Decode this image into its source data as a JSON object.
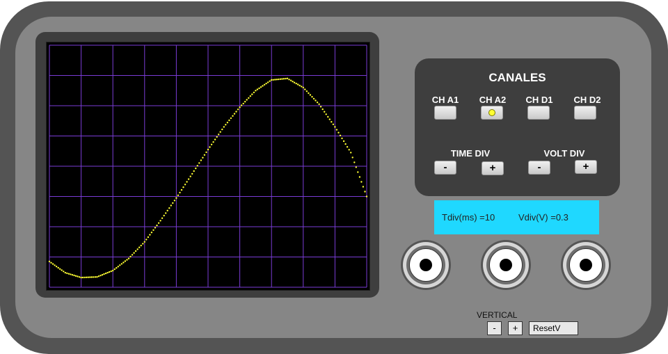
{
  "panel": {
    "title": "CANALES",
    "channels": [
      {
        "label": "CH A1",
        "active": false
      },
      {
        "label": "CH A2",
        "active": true
      },
      {
        "label": "CH D1",
        "active": false
      },
      {
        "label": "CH D2",
        "active": false
      }
    ],
    "time_div_label": "TIME DIV",
    "volt_div_label": "VOLT DIV",
    "minus": "-",
    "plus": "+"
  },
  "readout": {
    "tdiv": "Tdiv(ms) =10",
    "vdiv": "Vdiv(V) =0.3"
  },
  "vertical": {
    "label": "VERTICAL",
    "minus": "-",
    "plus": "+",
    "reset": "ResetV"
  },
  "colors": {
    "trace": "#ffff33",
    "grid": "#7a3cd6",
    "readout_bg": "#1fd8ff",
    "case_outer": "#545454",
    "case_inner": "#868686"
  },
  "chart_data": {
    "type": "line",
    "grid_divisions": {
      "x": 10,
      "y": 8
    },
    "series": [
      {
        "name": "",
        "x": [
          0,
          0.5,
          1,
          1.5,
          2,
          2.5,
          3,
          3.5,
          4,
          4.5,
          5,
          5.5,
          6,
          6.5,
          7,
          7.5,
          8,
          8.5,
          9,
          9.5,
          10
        ],
        "y": [
          0.85,
          0.48,
          0.32,
          0.34,
          0.55,
          0.95,
          1.5,
          2.2,
          2.95,
          3.75,
          4.55,
          5.3,
          5.95,
          6.5,
          6.85,
          6.9,
          6.6,
          6.05,
          5.3,
          4.45,
          3.0
        ]
      }
    ]
  }
}
